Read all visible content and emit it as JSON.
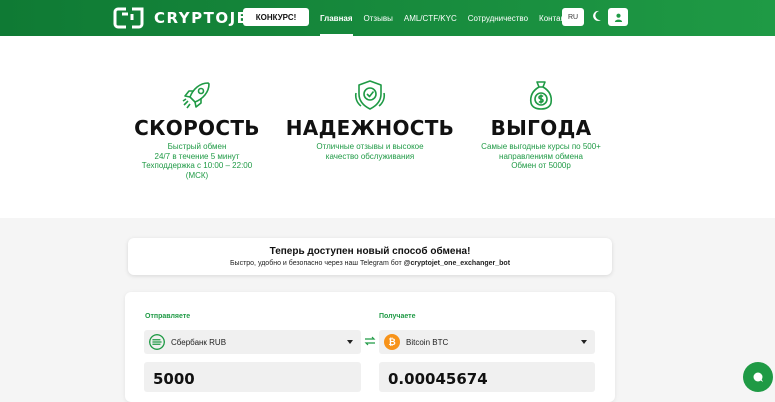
{
  "header": {
    "logo_text": "CRYPTOJET",
    "contest_label": "КОНКУРС!",
    "nav": [
      {
        "label": "Главная",
        "active": true
      },
      {
        "label": "Отзывы",
        "active": false
      },
      {
        "label": "AML/CTF/KYC",
        "active": false
      },
      {
        "label": "Сотрудничество",
        "active": false
      },
      {
        "label": "Контакты",
        "active": false
      }
    ],
    "lang": "RU",
    "theme_icon": "moon-icon",
    "user_icon": "user-icon"
  },
  "features": [
    {
      "icon": "rocket-icon",
      "title": "СКОРОСТЬ",
      "desc": "Быстрый обмен\n24/7 в течение 5 минут\nТехподдержка с 10:00 – 22:00\n(МСК)"
    },
    {
      "icon": "shield-check-icon",
      "title": "НАДЕЖНОСТЬ",
      "desc": "Отличные отзывы и высокое\nкачество обслуживания"
    },
    {
      "icon": "money-bag-icon",
      "title": "ВЫГОДА",
      "desc": "Самые выгодные курсы по 500+\nнаправлениям обмена\nОбмен от 5000р"
    }
  ],
  "banner": {
    "title": "Теперь доступен новый способ обмена!",
    "sub_prefix": "Быстро, удобно и безопасно через наш Telegram бот ",
    "sub_bot": "@cryptojet_one_exchanger_bot"
  },
  "exchange": {
    "send_label": "Отправляете",
    "receive_label": "Получаете",
    "send_currency": "Сбербанк RUB",
    "receive_currency": "Bitcoin BTC",
    "send_amount": "5000",
    "receive_amount": "0.00045674"
  },
  "colors": {
    "brand": "#1f9a45",
    "brand_dark": "#0f7a34",
    "bitcoin": "#f7931a"
  }
}
